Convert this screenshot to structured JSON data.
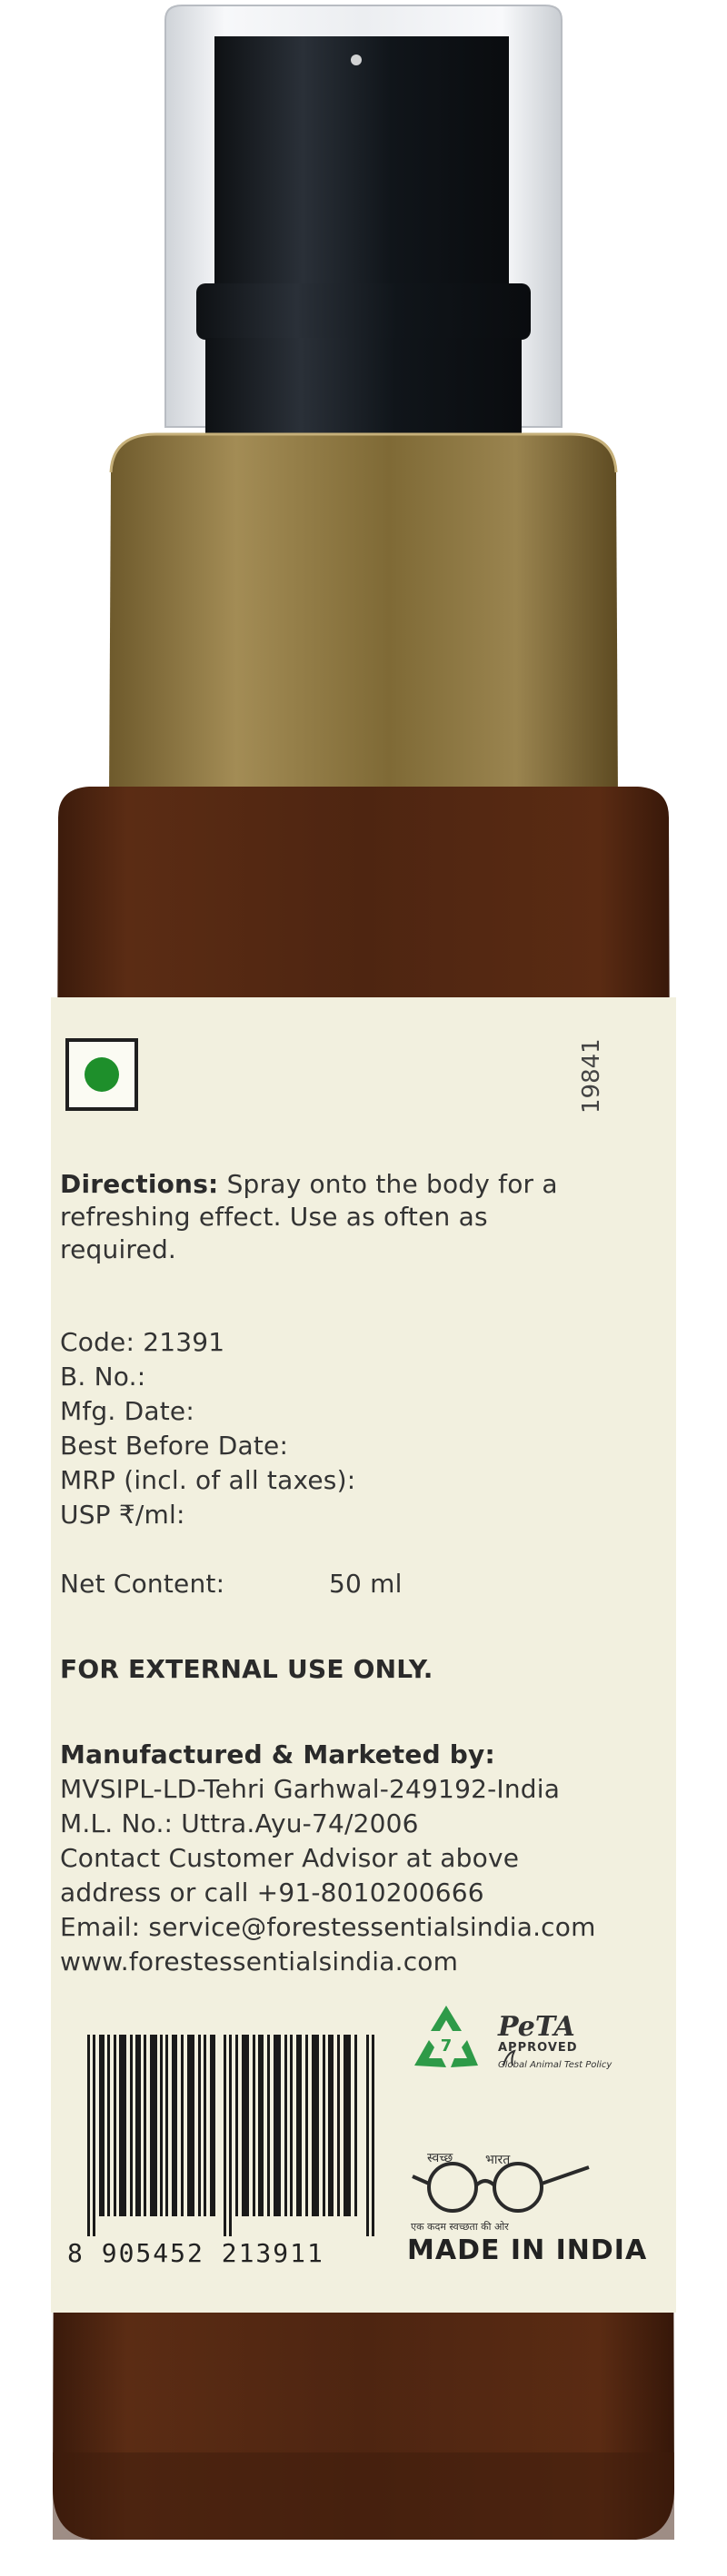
{
  "label": {
    "diet_mark": "veg-mark",
    "batch_code_vertical": "19841",
    "directions": {
      "heading": "Directions:",
      "text_line1": "Spray onto the body for a",
      "text_line2": "refreshing effect. Use as often as",
      "text_line3": "required."
    },
    "details": {
      "code": "Code: 21391",
      "batch_no": "B. No.:",
      "mfg_date": "Mfg. Date:",
      "best_before": "Best Before Date:",
      "mrp": "MRP (incl. of all taxes):",
      "usp": "USP ₹/ml:",
      "net_content_label": "Net Content:",
      "net_content_value": "50 ml"
    },
    "warning": "FOR EXTERNAL USE ONLY.",
    "manufacturer": {
      "heading": "Manufactured & Marketed by:",
      "line1": "MVSIPL-LD-Tehri Garhwal-249192-India",
      "line2": "M.L. No.: Uttra.Ayu-74/2006",
      "line3": "Contact Customer Advisor at above",
      "line4": "address or call +91-8010200666",
      "line5": "Email: service@forestessentialsindia.com",
      "line6": "www.forestessentialsindia.com"
    },
    "barcode_number": "8 905452 213911",
    "peta": {
      "logo": "PeTA",
      "approved": "APPROVED",
      "policy": "Global Animal Test Policy"
    },
    "recycle_number": "7",
    "swachh": {
      "left": "स्वच्छ",
      "right": "भारत",
      "tagline": "एक कदम स्वच्छता की ओर"
    },
    "origin": "MADE IN INDIA"
  },
  "colors": {
    "bottle": "#4a2412",
    "label_bg": "#f2f0df",
    "collar_gold": "#8b7440",
    "veg_green": "#1e8f2b",
    "recycle_green": "#2e9a48"
  }
}
